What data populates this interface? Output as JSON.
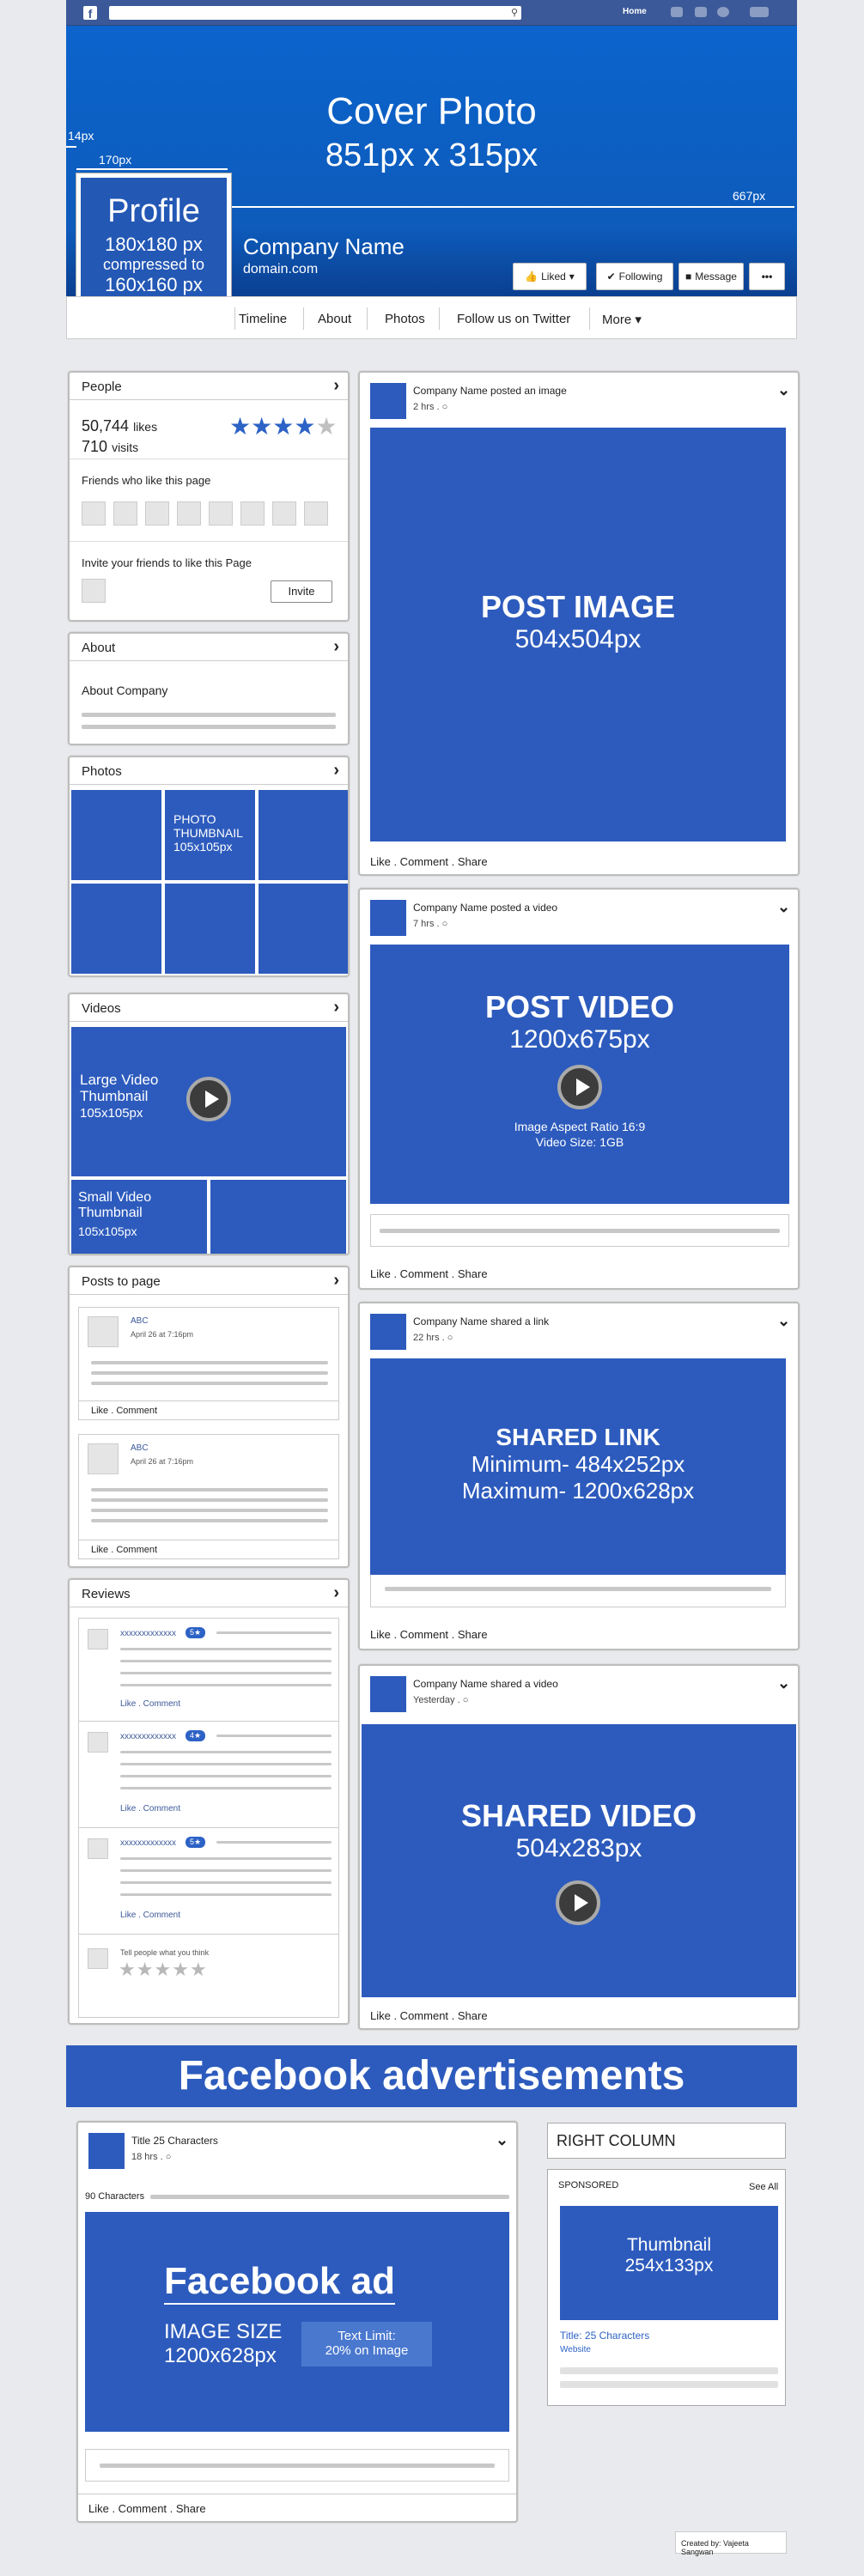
{
  "topbar": {
    "home_label": "Home",
    "search_placeholder": "",
    "logo": "f"
  },
  "cover": {
    "title": "Cover Photo",
    "dimension": "851px x 315px",
    "margin_label": "14px",
    "profile_width_label": "170px",
    "height_label": "667px"
  },
  "profile": {
    "label": "Profile",
    "size": "180x180 px",
    "compressed": "compressed to",
    "compressed_size": "160x160 px"
  },
  "company": {
    "name": "Company Name",
    "domain": "domain.com"
  },
  "cover_buttons": {
    "liked": "Liked",
    "following": "Following",
    "message": "Message",
    "more": "•••"
  },
  "nav": {
    "items": [
      "Timeline",
      "About",
      "Photos",
      "Follow us on Twitter",
      "More ▾"
    ]
  },
  "people": {
    "title": "People",
    "likes_count": "50,744",
    "likes_label": "likes",
    "visits_count": "710",
    "visits_label": "visits",
    "rating": 4,
    "rating_max": 5,
    "friends_label": "Friends who like this page",
    "invite_label": "Invite your friends to like this Page",
    "invite_button": "Invite"
  },
  "about": {
    "title": "About",
    "text": "About Company"
  },
  "photos": {
    "title": "Photos",
    "thumb_label": "PHOTO THUMBNAIL",
    "thumb_size": "105x105px"
  },
  "videos": {
    "title": "Videos",
    "large_label": "Large Video Thumbnail",
    "large_size": "105x105px",
    "small_label": "Small Video Thumbnail",
    "small_size": "105x105px"
  },
  "posts_to_page": {
    "title": "Posts to page",
    "items": [
      {
        "author": "ABC",
        "time": "April 26 at 7:16pm",
        "actions": "Like . Comment"
      },
      {
        "author": "ABC",
        "time": "April 26 at 7:16pm",
        "actions": "Like . Comment"
      }
    ]
  },
  "reviews": {
    "title": "Reviews",
    "items": [
      {
        "name": "xxxxxxxxxxxxx",
        "badge": "5★",
        "actions": "Like . Comment"
      },
      {
        "name": "xxxxxxxxxxxxx",
        "badge": "4★",
        "actions": "Like . Comment"
      },
      {
        "name": "xxxxxxxxxxxxx",
        "badge": "5★",
        "actions": "Like . Comment"
      }
    ],
    "tell_people": "Tell people what you think"
  },
  "posts": [
    {
      "author": "Company Name posted an image",
      "time": "2 hrs .",
      "title": "POST IMAGE",
      "size": "504x504px",
      "actions": "Like . Comment . Share"
    },
    {
      "author": "Company Name posted a video",
      "time": "7 hrs .",
      "title": "POST VIDEO",
      "size": "1200x675px",
      "note1": "Image Aspect Ratio 16:9",
      "note2": "Video Size: 1GB",
      "actions": "Like . Comment . Share"
    },
    {
      "author": "Company Name shared a link",
      "time": "22 hrs .",
      "title": "SHARED LINK",
      "min": "Minimum- 484x252px",
      "max": "Maximum- 1200x628px",
      "actions": "Like . Comment . Share"
    },
    {
      "author": "Company Name shared a video",
      "time": "Yesterday .",
      "title": "SHARED VIDEO",
      "size": "504x283px",
      "actions": "Like . Comment . Share"
    }
  ],
  "ads": {
    "banner": "Facebook advertisements",
    "ad_title": "Title 25 Characters",
    "ad_time": "18 hrs .",
    "ad_chars": "90 Characters",
    "ad_heading": "Facebook ad",
    "ad_image_size_label": "IMAGE SIZE",
    "ad_image_size": "1200x628px",
    "text_limit_1": "Text Limit:",
    "text_limit_2": "20% on Image",
    "ad_actions": "Like . Comment . Share",
    "right_column": "RIGHT COLUMN",
    "sponsored": "SPONSORED",
    "see_all": "See All",
    "thumb_label": "Thumbnail",
    "thumb_size": "254x133px",
    "rc_title": "Title: 25 Characters",
    "rc_website": "Website"
  },
  "credit": "Created by: Vajeeta Sangwan",
  "colors": {
    "brand_blue": "#2d5bbd",
    "topbar": "#3b5998",
    "cover": "#0c64cc"
  },
  "icons": [
    "facebook-logo-icon",
    "search-icon",
    "friends-icon",
    "messages-icon",
    "globe-icon",
    "chevron-right-icon",
    "star-icon",
    "play-icon",
    "chevron-down-icon",
    "check-icon",
    "message-icon",
    "globe-small-icon"
  ]
}
